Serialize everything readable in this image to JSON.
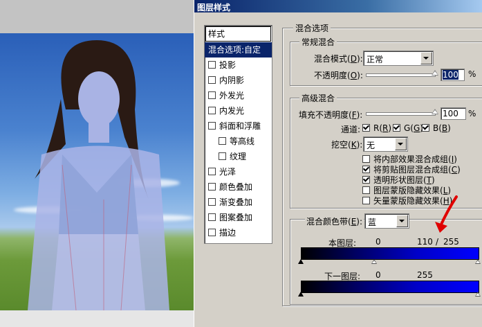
{
  "dialog": {
    "title": "图层样式"
  },
  "style_list": {
    "header": "样式",
    "items": [
      {
        "label": "混合选项:自定",
        "selected": true,
        "checkbox": false,
        "indent": false
      },
      {
        "label": "投影",
        "checkbox": true,
        "checked": false,
        "indent": false
      },
      {
        "label": "内阴影",
        "checkbox": true,
        "checked": false,
        "indent": false
      },
      {
        "label": "外发光",
        "checkbox": true,
        "checked": false,
        "indent": false
      },
      {
        "label": "内发光",
        "checkbox": true,
        "checked": false,
        "indent": false
      },
      {
        "label": "斜面和浮雕",
        "checkbox": true,
        "checked": false,
        "indent": false
      },
      {
        "label": "等高线",
        "checkbox": true,
        "checked": false,
        "indent": true
      },
      {
        "label": "纹理",
        "checkbox": true,
        "checked": false,
        "indent": true
      },
      {
        "label": "光泽",
        "checkbox": true,
        "checked": false,
        "indent": false
      },
      {
        "label": "颜色叠加",
        "checkbox": true,
        "checked": false,
        "indent": false
      },
      {
        "label": "渐变叠加",
        "checkbox": true,
        "checked": false,
        "indent": false
      },
      {
        "label": "图案叠加",
        "checkbox": true,
        "checked": false,
        "indent": false
      },
      {
        "label": "描边",
        "checkbox": true,
        "checked": false,
        "indent": false
      }
    ]
  },
  "blend_options": {
    "section_title": "混合选项",
    "general": {
      "title": "常规混合",
      "mode_label": "混合模式(",
      "mode_key": "D",
      "mode_suffix": "):",
      "mode_value": "正常",
      "opacity_label": "不透明度(",
      "opacity_key": "O",
      "opacity_suffix": "):",
      "opacity_value": "100",
      "opacity_unit": "%"
    },
    "advanced": {
      "title": "高级混合",
      "fill_label": "填充不透明度(",
      "fill_key": "F",
      "fill_suffix": "):",
      "fill_value": "100",
      "fill_unit": "%",
      "channels_label": "通道:",
      "channels": [
        {
          "label": "R(",
          "key": "R",
          "suffix": ")",
          "checked": true
        },
        {
          "label": "G(",
          "key": "G",
          "suffix": ")",
          "checked": true
        },
        {
          "label": "B(",
          "key": "B",
          "suffix": ")",
          "checked": true
        }
      ],
      "knockout_label": "挖空(",
      "knockout_key": "K",
      "knockout_suffix": "):",
      "knockout_value": "无",
      "options": [
        {
          "label": "将内部效果混合成组(",
          "key": "I",
          "suffix": ")",
          "checked": false
        },
        {
          "label": "将剪贴图层混合成组(",
          "key": "C",
          "suffix": ")",
          "checked": true
        },
        {
          "label": "透明形状图层(",
          "key": "T",
          "suffix": ")",
          "checked": true
        },
        {
          "label": "图层蒙版隐藏效果(",
          "key": "L",
          "suffix": ")",
          "checked": false
        },
        {
          "label": "矢量蒙版隐藏效果(",
          "key": "H",
          "suffix": ")",
          "checked": false
        }
      ]
    },
    "blend_if": {
      "label": "混合颜色带(",
      "key": "E",
      "suffix": "):",
      "value": "蓝",
      "this_layer_label": "本图层:",
      "this_layer_low": "0",
      "this_layer_high_a": "110",
      "this_layer_sep": "/",
      "this_layer_high_b": "255",
      "underlying_label": "下一图层:",
      "underlying_low": "0",
      "underlying_high": "255"
    }
  },
  "colors": {
    "title_gradient_start": "#0a246a",
    "selection": "#0a246a",
    "arrow": "#e00000",
    "band_end": "#0000ff"
  }
}
